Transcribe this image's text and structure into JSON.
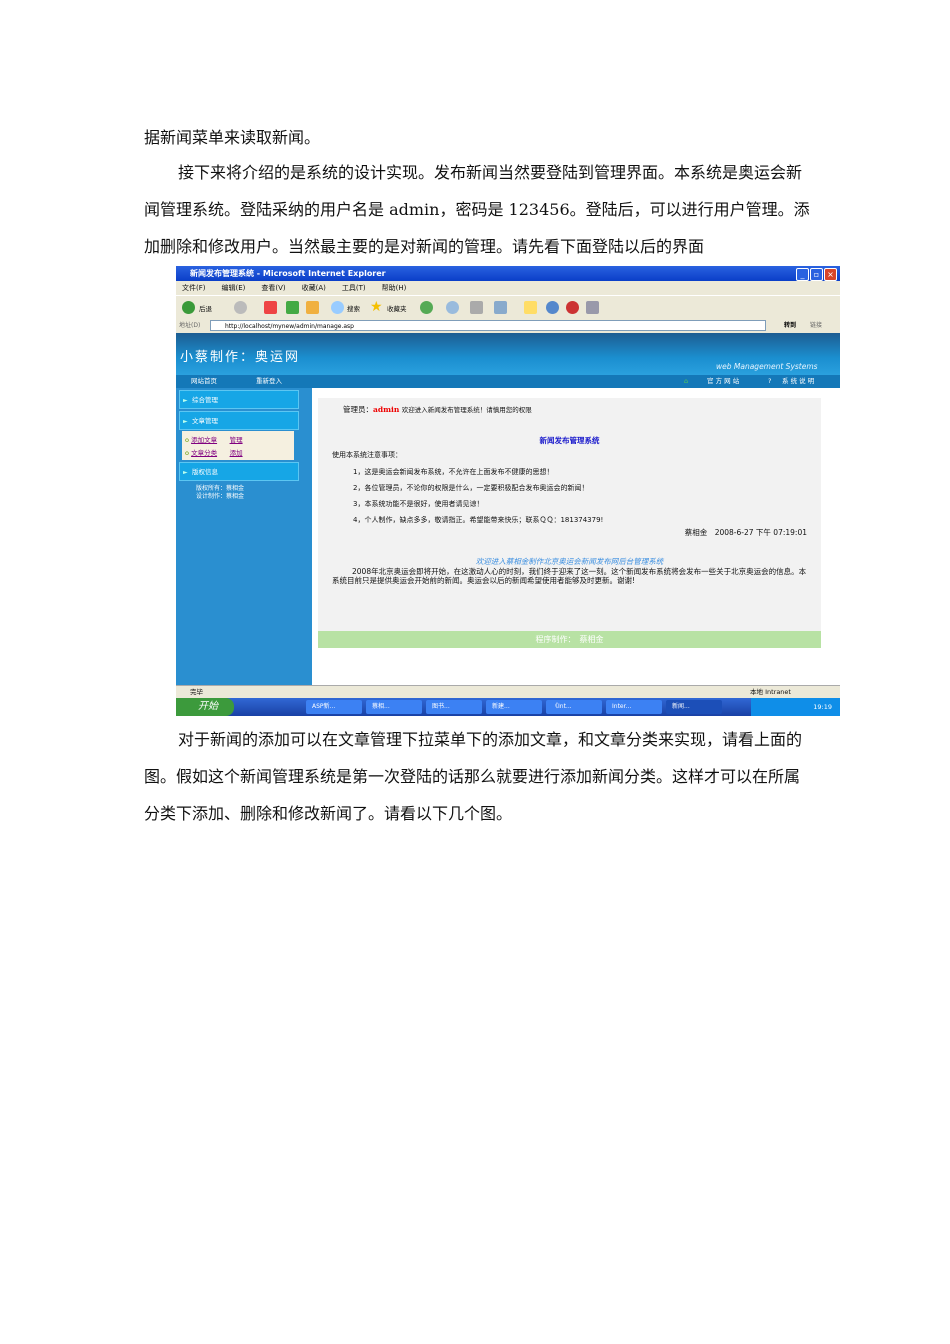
{
  "paragraphs": {
    "p1": "据新闻菜单来读取新闻。",
    "p2": "接下来将介绍的是系统的设计实现。发布新闻当然要登陆到管理界面。本系统是奥运会新闻管理系统。登陆采纳的用户名是 admin，密码是 123456。登陆后，可以进行用户管理。添加删除和修改用户。当然最主要的是对新闻的管理。请先看下面登陆以后的界面",
    "p3": "对于新闻的添加可以在文章管理下拉菜单下的添加文章，和文章分类来实现，请看上面的图。假如这个新闻管理系统是第一次登陆的话那么就要进行添加新闻分类。这样才可以在所属分类下添加、删除和修改新闻了。请看以下几个图。"
  },
  "browser": {
    "title": "新闻发布管理系统 - Microsoft Internet Explorer",
    "menu": [
      "文件(F)",
      "编辑(E)",
      "查看(V)",
      "收藏(A)",
      "工具(T)",
      "帮助(H)"
    ],
    "back": "后退",
    "search": "搜索",
    "favorites": "收藏夹",
    "address_label": "地址(D)",
    "url": "http://localhost/mynew/admin/manage.asp",
    "go": "转到",
    "links": "链接"
  },
  "site": {
    "logo": "小蔡制作：奥运网",
    "tagline": "web Management Systems",
    "nav": [
      "网站首页",
      "重新登入"
    ],
    "official": "官 方 网 站",
    "help": "系 统 说 明",
    "sidebar": {
      "h1": "综合管理",
      "h2": "文章管理",
      "add_article": "添加文章",
      "manage": "管理",
      "category": "文章分类",
      "add": "添加",
      "h3": "版权信息",
      "copyright": "版权所有：蔡相金",
      "design": "设计制作：蔡相金"
    },
    "admin_label": "管理员：",
    "admin_name": "admin",
    "welcome": "欢迎进入新闻发布管理系统！请慎用您的权限",
    "sys_title": "新闻发布管理系统",
    "notes_title": "使用本系统注意事项：",
    "notes": [
      "1，这是奥运会新闻发布系统，不允许在上面发布不健康的思想！",
      "2，各位管理员，不论你的权限是什么，一定要积极配合发布奥运会的新闻！",
      "3，本系统功能不是很好，使用者请见谅！",
      "4，个人制作，缺点多多，敬请指正。希望能带来快乐；联系ＱＱ：181374379!"
    ],
    "signature": "蔡相金　2008-6-27 下午 07:19:01",
    "welcome2": "欢迎进入蔡相金制作北京奥运会新闻发布网后台管理系统",
    "intro": "2008年北京奥运会即将开始，在这激动人心的时刻，我们终于迎来了这一刻。这个新闻发布系统将会发布一些关于北京奥运会的信息。本系统目前只是提供奥运会开始前的新闻。奥运会以后的新闻希望使用者能够及时更新。谢谢!",
    "footer": "程序制作：　蔡相金"
  },
  "status": {
    "done": "完毕",
    "zone": "本地 Intranet"
  },
  "taskbar": {
    "start": "开始",
    "tasks": [
      "ASP新...",
      "蔡相...",
      "图书...",
      "新建...",
      "《Int...",
      "Inter...",
      "新闻..."
    ],
    "clock": "19:19"
  }
}
